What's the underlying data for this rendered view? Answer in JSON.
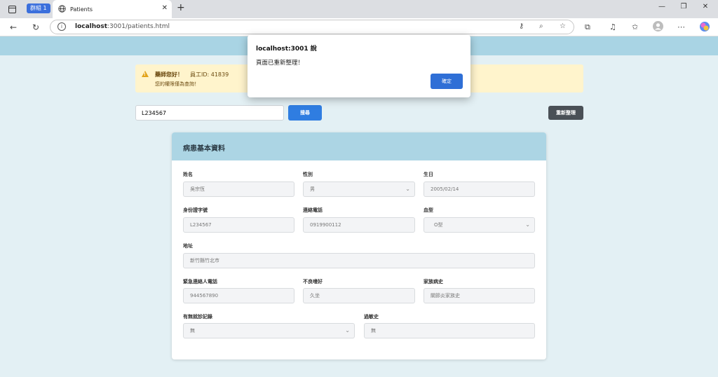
{
  "browser": {
    "group_label": "群組 1",
    "tab_title": "Patients",
    "url_host": "localhost",
    "url_rest": ":3001/patients.html"
  },
  "alert": {
    "greeting": "藥師您好！",
    "employee": "員工ID: 41839",
    "permission": "您的權限僅為查詢！"
  },
  "search": {
    "value": "L234567",
    "button_label": "搜尋"
  },
  "reload_label": "重新整理",
  "card": {
    "title": "病患基本資料",
    "fields": {
      "name": {
        "label": "姓名",
        "value": "吳宗恆"
      },
      "gender": {
        "label": "性別",
        "value": "男"
      },
      "birthday": {
        "label": "生日",
        "value": "2005/02/14"
      },
      "id_number": {
        "label": "身份證字號",
        "value": "L234567"
      },
      "phone": {
        "label": "連絡電話",
        "value": "0919900112"
      },
      "blood_type": {
        "label": "血型",
        "value": "O型"
      },
      "address": {
        "label": "地址",
        "value": "新竹縣竹北市"
      },
      "emergency_phone": {
        "label": "緊急連絡人電話",
        "value": "944567890"
      },
      "bad_habits": {
        "label": "不良嗜好",
        "value": "久坐"
      },
      "family_history": {
        "label": "家族病史",
        "value": "關節炎家族史"
      },
      "visit_record": {
        "label": "有無就診記錄",
        "value": "無"
      },
      "allergy": {
        "label": "過敏史",
        "value": "無"
      }
    }
  },
  "dialog": {
    "title": "localhost:3001 說",
    "message": "頁面已重新整理！",
    "ok_label": "確定"
  }
}
